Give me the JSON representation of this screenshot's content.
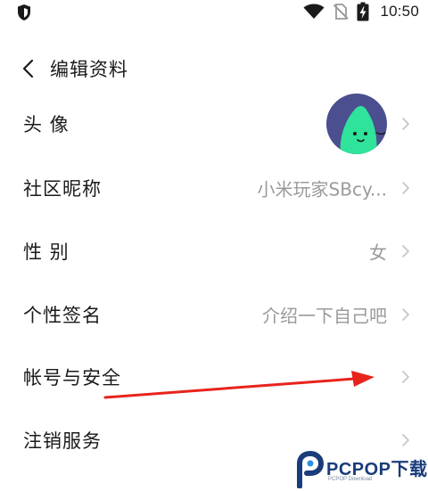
{
  "status_bar": {
    "time": "10:50",
    "icons": [
      "shield-icon",
      "wifi-icon",
      "no-sim-icon",
      "battery-charging-icon"
    ]
  },
  "header": {
    "title": "编辑资料",
    "back_icon": "chevron-left-icon"
  },
  "rows": [
    {
      "label": "头 像",
      "type": "avatar",
      "value": ""
    },
    {
      "label": "社区昵称",
      "type": "text",
      "value": "小米玩家SBcy..."
    },
    {
      "label": "性 别",
      "type": "text",
      "value": "女"
    },
    {
      "label": "个性签名",
      "type": "text",
      "value": "介绍一下自己吧"
    },
    {
      "label": "帐号与安全",
      "type": "text",
      "value": ""
    },
    {
      "label": "注销服务",
      "type": "text",
      "value": ""
    }
  ],
  "colors": {
    "text_primary": "#1a1a1a",
    "text_secondary": "#9a9a9a",
    "chevron": "#c4c4c4",
    "avatar_bg": "#4b4f8f",
    "avatar_character": "#2fe39a",
    "annotation_arrow": "#e8231c",
    "watermark": "#1a3c7a"
  },
  "watermark": {
    "brand": "PCPOP下载",
    "sub": "PCPOP Download"
  }
}
